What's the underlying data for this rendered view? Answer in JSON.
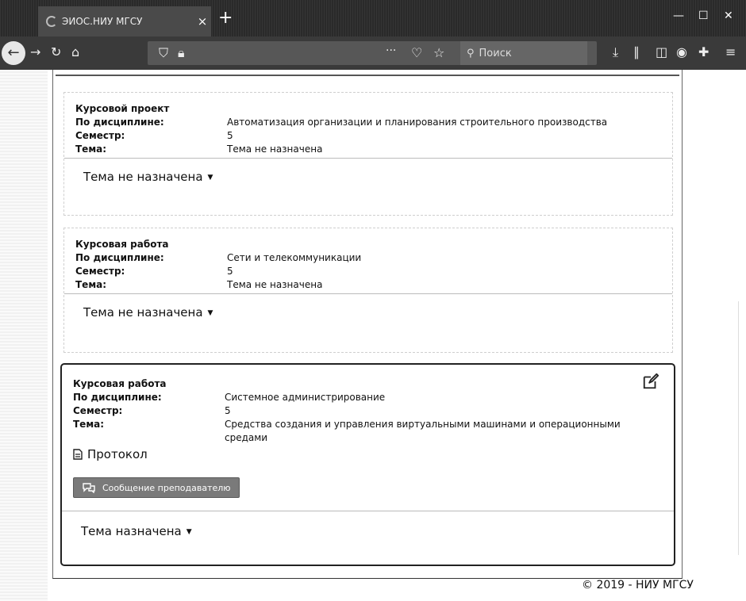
{
  "browser": {
    "tab_title": "ЭИОС.НИУ МГСУ",
    "tab_close": "×",
    "new_tab": "+",
    "search_placeholder": "Поиск",
    "url": "",
    "more": "···"
  },
  "cards": [
    {
      "title": "Курсовой проект",
      "discipline_label": "По дисциплине:",
      "discipline": "Автоматизация организации и планирования строительного производства",
      "semester_label": "Семестр:",
      "semester": "5",
      "topic_label": "Тема:",
      "topic": "Тема не назначена",
      "status": "Тема не назначена"
    },
    {
      "title": "Курсовая работа",
      "discipline_label": "По дисциплине:",
      "discipline": "Сети и телекоммуникации",
      "semester_label": "Семестр:",
      "semester": "5",
      "topic_label": "Тема:",
      "topic": "Тема не назначена",
      "status": "Тема не назначена"
    },
    {
      "title": "Курсовая работа",
      "discipline_label": "По дисциплине:",
      "discipline": "Системное администрирование",
      "semester_label": "Семестр:",
      "semester": "5",
      "topic_label": "Тема:",
      "topic": "Средства создания и управления виртуальными машинами и операционными средами",
      "protocol_label": "Протокол",
      "message_button": "Сообщение преподавателю",
      "status": "Тема назначена"
    }
  ],
  "footer": {
    "copyright": "© 2019 - НИУ МГСУ"
  }
}
